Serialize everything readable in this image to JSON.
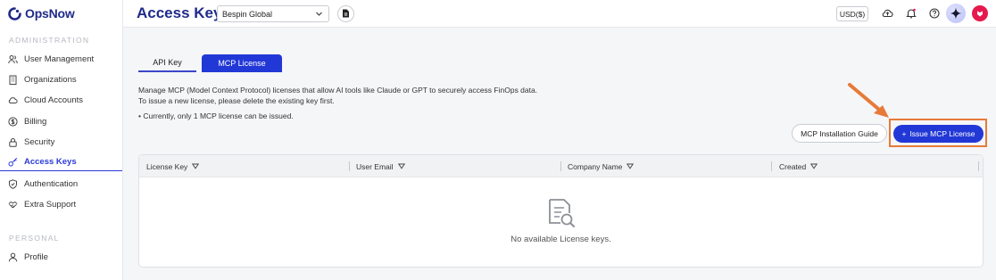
{
  "brand": {
    "name": "OpsNow"
  },
  "sidebar": {
    "section_admin": "ADMINISTRATION",
    "section_personal": "PERSONAL",
    "items": [
      {
        "label": "User Management",
        "icon": "users-icon"
      },
      {
        "label": "Organizations",
        "icon": "building-icon"
      },
      {
        "label": "Cloud Accounts",
        "icon": "cloud-icon"
      },
      {
        "label": "Billing",
        "icon": "dollar-icon"
      },
      {
        "label": "Security",
        "icon": "lock-icon"
      },
      {
        "label": "Access Keys",
        "icon": "key-icon",
        "active": true
      },
      {
        "label": "Authentication",
        "icon": "shield-icon"
      },
      {
        "label": "Extra Support",
        "icon": "handshake-icon"
      }
    ],
    "personal_items": [
      {
        "label": "Profile",
        "icon": "user-icon"
      }
    ]
  },
  "header": {
    "title": "Access Keys",
    "org_select": "Bespin Global",
    "currency": "USD($)"
  },
  "tabs": [
    {
      "label": "API Key",
      "selected": false
    },
    {
      "label": "MCP License",
      "selected": true
    }
  ],
  "description": {
    "line1": "Manage MCP (Model Context Protocol) licenses that allow AI tools like Claude or GPT to securely access FinOps data.",
    "line2": "To issue a new license, please delete the existing key first.",
    "note": "• Currently, only 1 MCP license can be issued."
  },
  "actions": {
    "guide_label": "MCP Installation Guide",
    "issue_label": "Issue MCP License",
    "issue_prefix": "+"
  },
  "table": {
    "columns": [
      "License Key",
      "User Email",
      "Company Name",
      "Created"
    ],
    "empty_text": "No available License keys."
  },
  "colors": {
    "primary": "#2238d6",
    "brand_text": "#1f2a8a",
    "highlight": "#e77a39",
    "avatar": "#e5194d"
  }
}
